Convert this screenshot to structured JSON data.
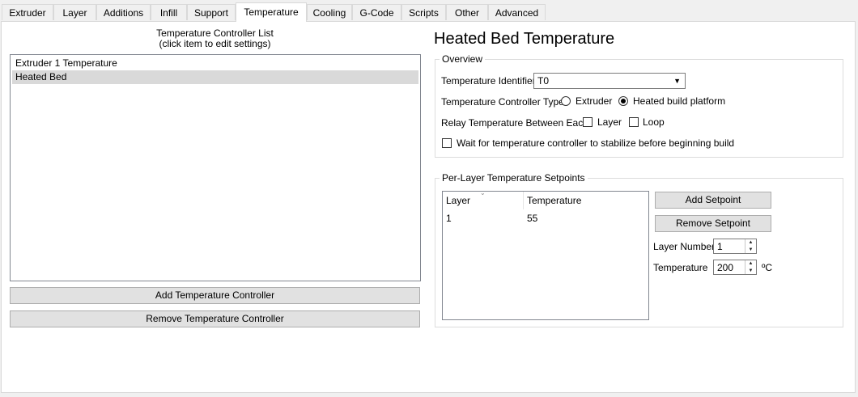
{
  "tabs": [
    "Extruder",
    "Layer",
    "Additions",
    "Infill",
    "Support",
    "Temperature",
    "Cooling",
    "G-Code",
    "Scripts",
    "Other",
    "Advanced"
  ],
  "active_tab": "Temperature",
  "controller_list": {
    "title_line1": "Temperature Controller List",
    "title_line2": "(click item to edit settings)",
    "items": [
      "Extruder 1 Temperature",
      "Heated Bed"
    ],
    "selected": "Heated Bed",
    "add_button": "Add Temperature Controller",
    "remove_button": "Remove Temperature Controller"
  },
  "detail": {
    "title": "Heated Bed Temperature",
    "overview": {
      "label": "Overview",
      "identifier_label": "Temperature Identifier",
      "identifier_value": "T0",
      "type_label": "Temperature Controller Type:",
      "type_options": [
        "Extruder",
        "Heated build platform"
      ],
      "type_selected": "Heated build platform",
      "relay_label": "Relay Temperature Between Each:",
      "relay_options": [
        "Layer",
        "Loop"
      ],
      "wait_label": "Wait for temperature controller to stabilize before beginning build"
    },
    "setpoints": {
      "label": "Per-Layer Temperature Setpoints",
      "columns": [
        "Layer",
        "Temperature"
      ],
      "rows": [
        [
          "1",
          "55"
        ]
      ],
      "add_button": "Add Setpoint",
      "remove_button": "Remove Setpoint",
      "layer_number_label": "Layer Number",
      "layer_number_value": "1",
      "temperature_label": "Temperature",
      "temperature_value": "200",
      "unit": "ºC"
    }
  }
}
